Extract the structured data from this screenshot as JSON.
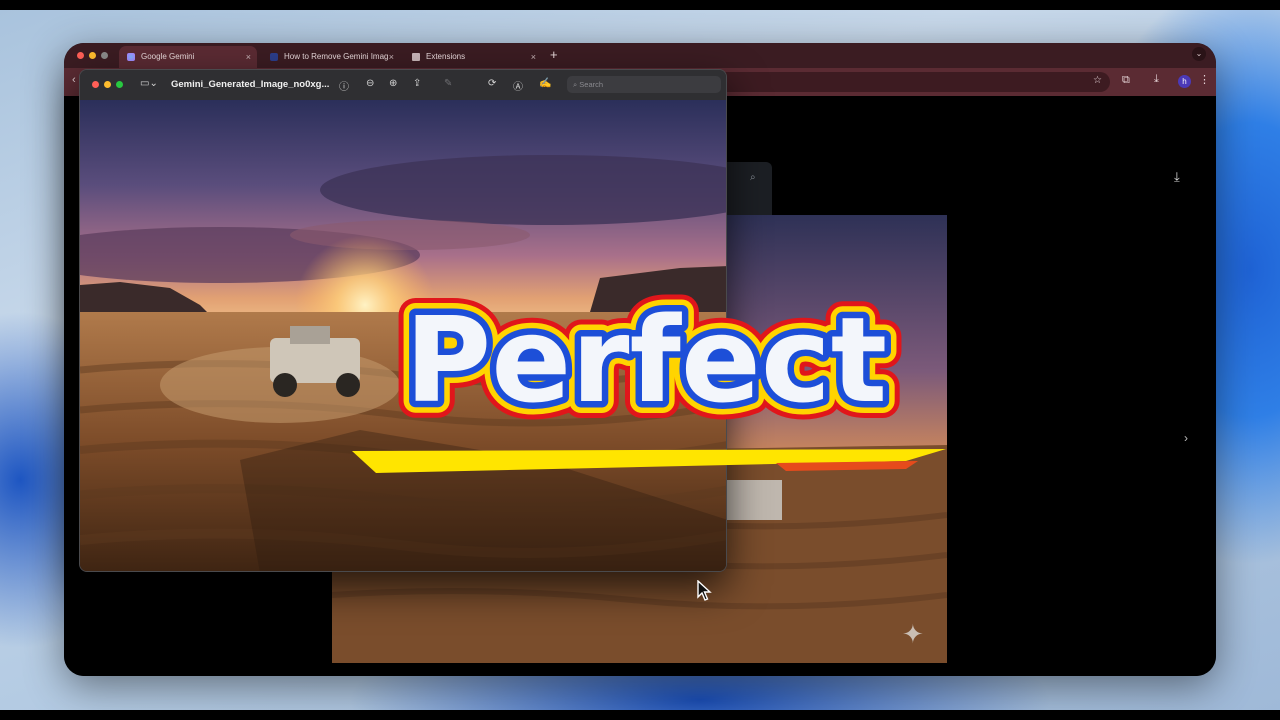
{
  "browser": {
    "tabs": [
      {
        "label": "Google Gemini",
        "active": true,
        "favicon": "gemini-sparkle-icon"
      },
      {
        "label": "How to Remove Gemini Imag",
        "active": false,
        "favicon": "page-icon"
      },
      {
        "label": "Extensions",
        "active": false,
        "favicon": "puzzle-icon"
      }
    ],
    "new_tab_label": "+",
    "close_label": "×",
    "profile_initial": "h"
  },
  "preview": {
    "file_name": "Gemini_Generated_Image_no0xg...",
    "search_placeholder": "Search"
  },
  "overlay": {
    "caption": "Perfect"
  },
  "colors": {
    "tab_strip": "#3b1c22",
    "toolbar": "#5b2b33",
    "caption_fill": "#f3f6fb",
    "caption_outline_inner": "#1d4fd8",
    "caption_outline_mid": "#ffd400",
    "caption_outline_outer": "#e0161b"
  }
}
